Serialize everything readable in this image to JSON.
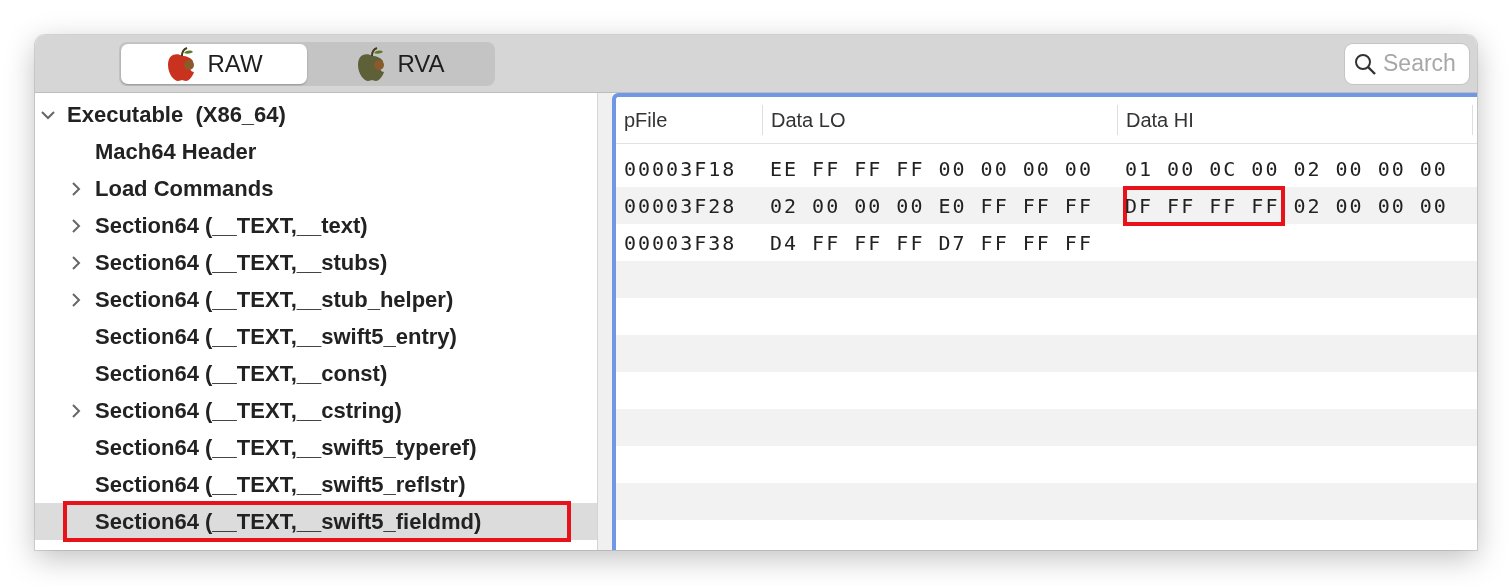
{
  "segments": [
    {
      "label": "RAW",
      "selected": true,
      "color": "#c8321e"
    },
    {
      "label": "RVA",
      "selected": false,
      "color": "#5e6138"
    }
  ],
  "search": {
    "placeholder": "Search"
  },
  "tree": [
    {
      "label": "Executable  (X86_64)",
      "expanded": true,
      "selected": false,
      "annotated": false,
      "children": [
        {
          "label": "Mach64 Header",
          "expandable": false,
          "selected": false,
          "annotated": false
        },
        {
          "label": "Load Commands",
          "expandable": true,
          "selected": false,
          "annotated": false
        },
        {
          "label": "Section64 (__TEXT,__text)",
          "expandable": true,
          "selected": false,
          "annotated": false
        },
        {
          "label": "Section64 (__TEXT,__stubs)",
          "expandable": true,
          "selected": false,
          "annotated": false
        },
        {
          "label": "Section64 (__TEXT,__stub_helper)",
          "expandable": true,
          "selected": false,
          "annotated": false
        },
        {
          "label": "Section64 (__TEXT,__swift5_entry)",
          "expandable": false,
          "selected": false,
          "annotated": false
        },
        {
          "label": "Section64 (__TEXT,__const)",
          "expandable": false,
          "selected": false,
          "annotated": false
        },
        {
          "label": "Section64 (__TEXT,__cstring)",
          "expandable": true,
          "selected": false,
          "annotated": false
        },
        {
          "label": "Section64 (__TEXT,__swift5_typeref)",
          "expandable": false,
          "selected": false,
          "annotated": false
        },
        {
          "label": "Section64 (__TEXT,__swift5_reflstr)",
          "expandable": false,
          "selected": false,
          "annotated": false
        },
        {
          "label": "Section64 (__TEXT,__swift5_fieldmd)",
          "expandable": false,
          "selected": true,
          "annotated": true
        }
      ]
    }
  ],
  "table": {
    "columns": [
      "pFile",
      "Data LO",
      "Data HI"
    ],
    "rows": [
      {
        "pfile": "00003F18",
        "data_lo": "EE FF FF FF 00 00 00 00",
        "data_hi": [
          {
            "text": "01 00 0C 00",
            "annotated": false
          },
          {
            "text": "02 00 00 00",
            "annotated": false
          }
        ]
      },
      {
        "pfile": "00003F28",
        "data_lo": "02 00 00 00 E0 FF FF FF",
        "data_hi": [
          {
            "text": "DF FF FF FF",
            "annotated": true
          },
          {
            "text": "02 00 00 00",
            "annotated": false
          }
        ]
      },
      {
        "pfile": "00003F38",
        "data_lo": "D4 FF FF FF D7 FF FF FF"
      }
    ]
  }
}
